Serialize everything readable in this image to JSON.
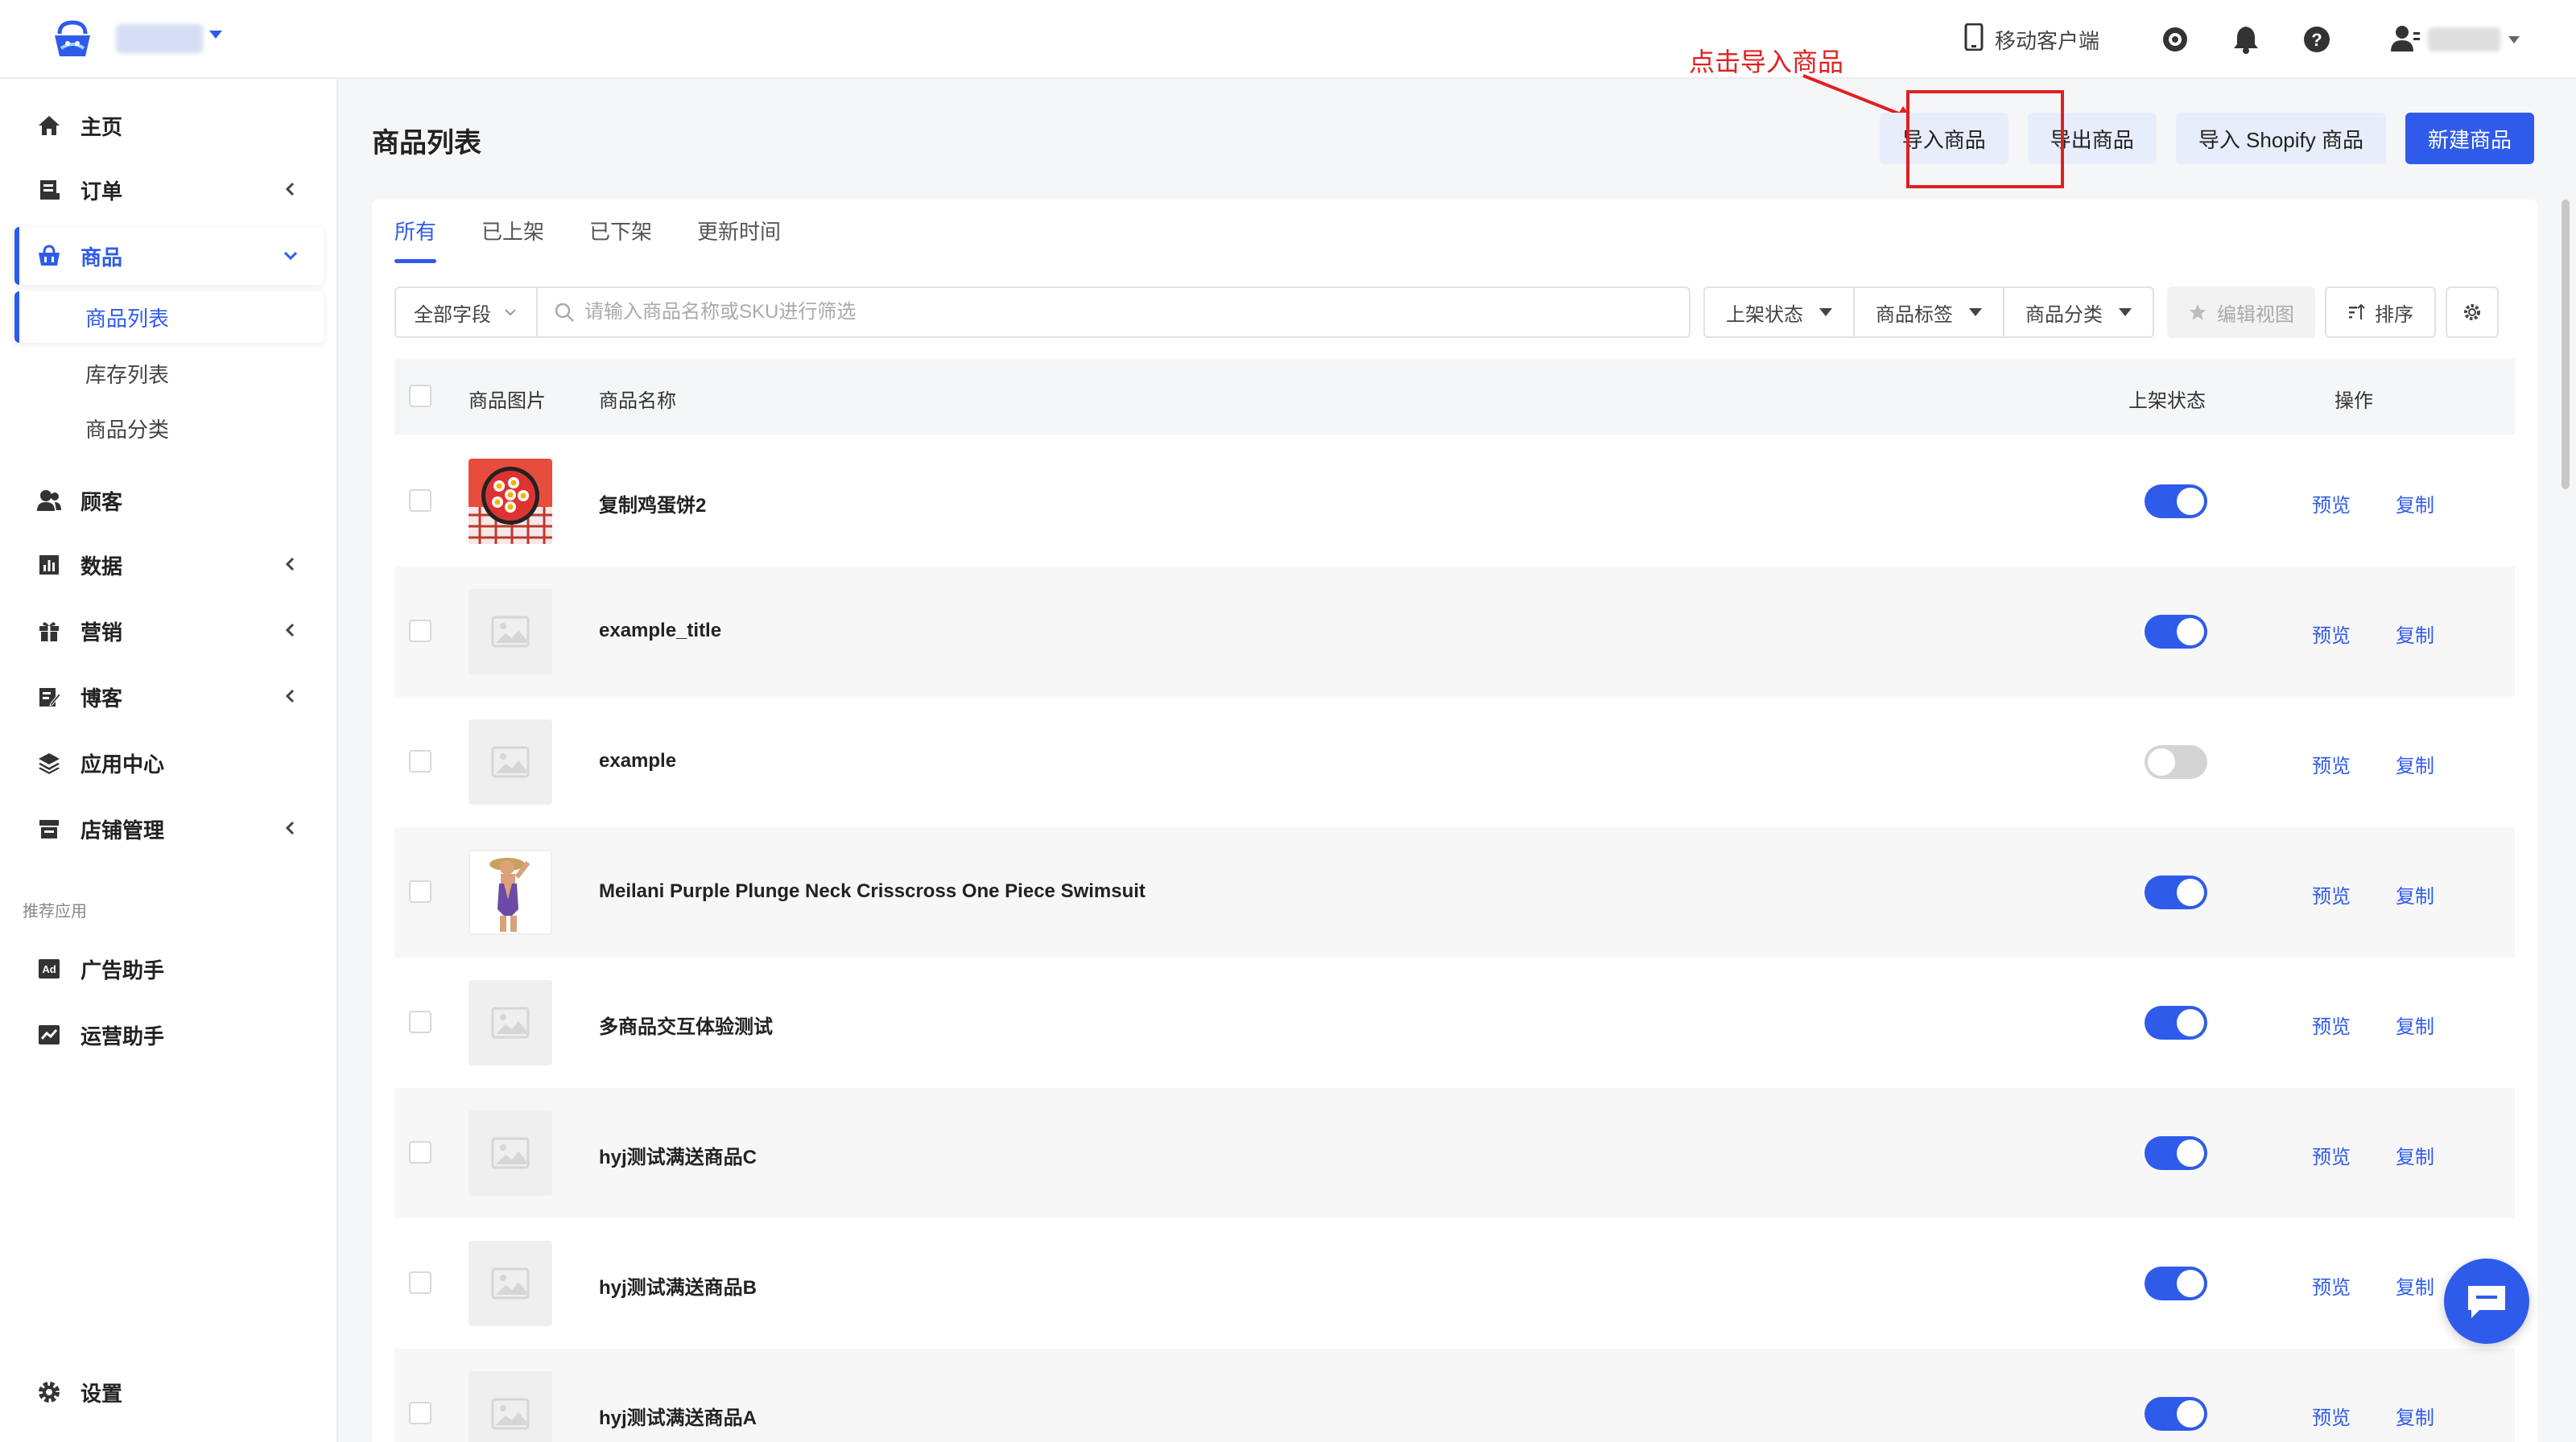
{
  "topbar": {
    "mobile_client": "移动客户端"
  },
  "annotation": {
    "text": "点击导入商品",
    "color": "#e02020"
  },
  "sidebar": {
    "items": [
      {
        "label": "主页",
        "icon": "home-icon"
      },
      {
        "label": "订单",
        "icon": "order-icon"
      },
      {
        "label": "商品",
        "icon": "basket-icon"
      },
      {
        "label": "顾客",
        "icon": "users-icon"
      },
      {
        "label": "数据",
        "icon": "chart-icon"
      },
      {
        "label": "营销",
        "icon": "gift-icon"
      },
      {
        "label": "博客",
        "icon": "edit-icon"
      },
      {
        "label": "应用中心",
        "icon": "layers-icon"
      },
      {
        "label": "店铺管理",
        "icon": "store-icon"
      }
    ],
    "sub_items": [
      "商品列表",
      "库存列表",
      "商品分类"
    ],
    "section_label": "推荐应用",
    "apps": [
      {
        "label": "广告助手",
        "icon": "ad-icon"
      },
      {
        "label": "运营助手",
        "icon": "trend-icon"
      }
    ],
    "settings": "设置"
  },
  "page": {
    "title": "商品列表",
    "actions": [
      "导入商品",
      "导出商品",
      "导入 Shopify 商品",
      "新建商品"
    ]
  },
  "tabs": [
    "所有",
    "已上架",
    "已下架",
    "更新时间"
  ],
  "filters": {
    "field": "全部字段",
    "search_placeholder": "请输入商品名称或SKU进行筛选",
    "dropdowns": [
      "上架状态",
      "商品标签",
      "商品分类"
    ],
    "edit_view": "编辑视图",
    "sort": "排序"
  },
  "table": {
    "headers": [
      "商品图片",
      "商品名称",
      "上架状态",
      "操作"
    ],
    "row_actions": [
      "预览",
      "复制"
    ],
    "rows": [
      {
        "name": "复制鸡蛋饼2",
        "on": true,
        "thumb": "food"
      },
      {
        "name": "example_title",
        "on": true,
        "thumb": "placeholder"
      },
      {
        "name": "example",
        "on": false,
        "thumb": "placeholder"
      },
      {
        "name": "Meilani Purple Plunge Neck Crisscross One Piece Swimsuit",
        "on": true,
        "thumb": "swimsuit"
      },
      {
        "name": "多商品交互体验测试",
        "on": true,
        "thumb": "placeholder"
      },
      {
        "name": "hyj测试满送商品C",
        "on": true,
        "thumb": "placeholder"
      },
      {
        "name": "hyj测试满送商品B",
        "on": true,
        "thumb": "placeholder"
      },
      {
        "name": "hyj测试满送商品A",
        "on": true,
        "thumb": "placeholder"
      }
    ]
  },
  "colors": {
    "accent": "#2f5bea",
    "highlight": "#e02020"
  }
}
